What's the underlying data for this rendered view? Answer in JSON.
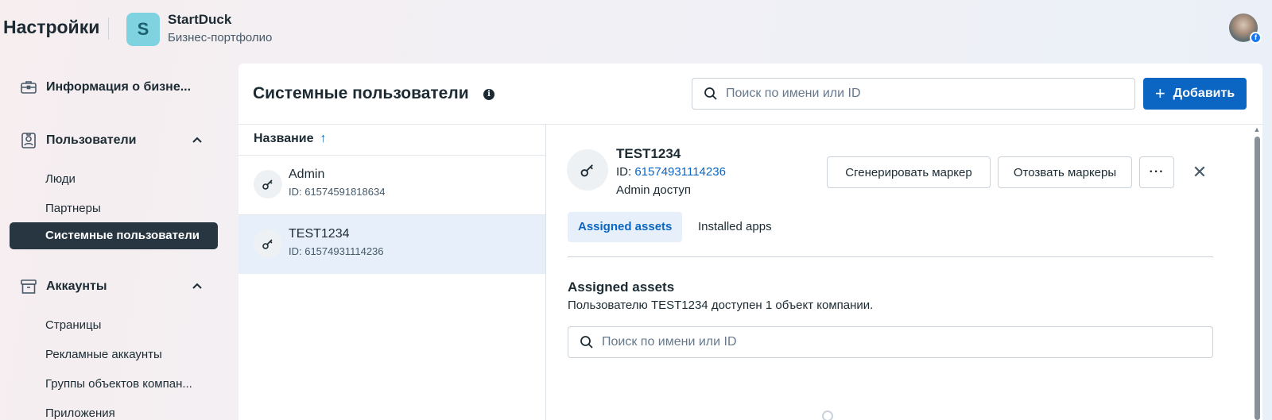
{
  "header": {
    "title": "Настройки",
    "business_logo_letter": "S",
    "business_name": "StartDuck",
    "business_subtitle": "Бизнес-портфолио"
  },
  "sidebar": {
    "business_info": {
      "label": "Информация о бизне...",
      "icon": "briefcase-icon"
    },
    "users_group": {
      "label": "Пользователи",
      "icon": "id-badge-icon",
      "items": [
        "Люди",
        "Партнеры",
        "Системные пользователи"
      ],
      "active_item": "Системные пользователи"
    },
    "accounts_group": {
      "label": "Аккаунты",
      "icon": "archive-box-icon",
      "items": [
        "Страницы",
        "Рекламные аккаунты",
        "Группы объектов компан...",
        "Приложения"
      ]
    }
  },
  "main": {
    "title": "Системные пользователи",
    "search_placeholder": "Поиск по имени или ID",
    "add_button": "Добавить",
    "column_header": "Название",
    "users": [
      {
        "name": "Admin",
        "id": "ID: 61574591818634",
        "selected": false
      },
      {
        "name": "TEST1234",
        "id": "ID: 61574931114236",
        "selected": true
      }
    ]
  },
  "detail": {
    "name": "TEST1234",
    "id_prefix": "ID: ",
    "id_value": "61574931114236",
    "access": "Admin доступ",
    "generate_button": "Сгенерировать маркер",
    "revoke_button": "Отозвать маркеры",
    "more_button": "···",
    "tabs": [
      "Assigned assets",
      "Installed apps"
    ],
    "active_tab": "Assigned assets",
    "section_title": "Assigned assets",
    "section_description": "Пользователю TEST1234 доступен 1 объект компании.",
    "assets_search_placeholder": "Поиск по имени или ID"
  },
  "colors": {
    "accent": "#0a66c2",
    "active_nav_bg": "#283641",
    "selected_row_bg": "#e7f0fa",
    "logo_bg": "#7fd3e1"
  }
}
